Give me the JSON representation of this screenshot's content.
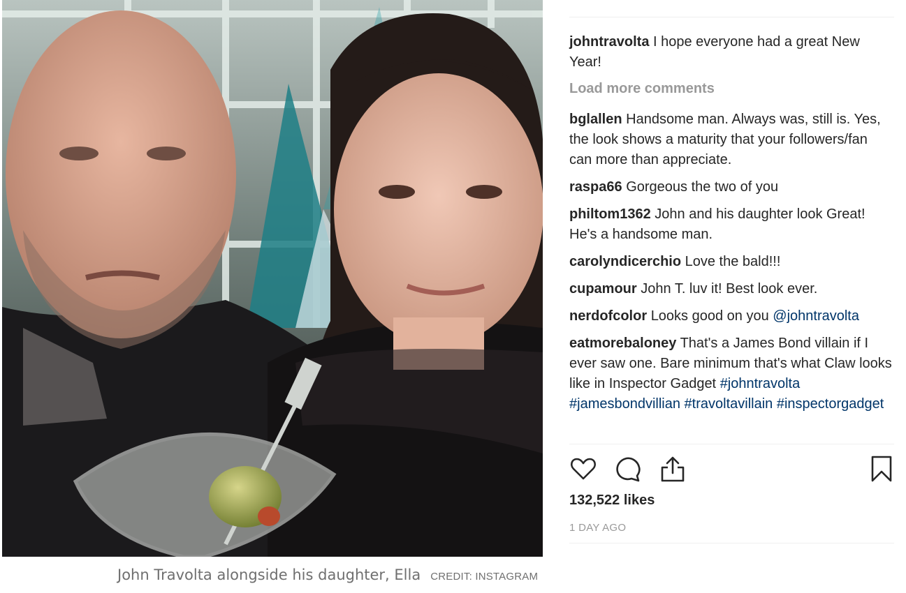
{
  "post": {
    "author": "johntravolta",
    "caption": "I hope everyone had a great New Year!",
    "load_more_label": "Load more comments",
    "comments": [
      {
        "user": "bglallen",
        "parts": [
          {
            "text": "Handsome man. Always was, still is. Yes, the look shows a maturity that your followers/fan can more than appreciate.",
            "tag": false
          }
        ]
      },
      {
        "user": "raspa66",
        "parts": [
          {
            "text": "Gorgeous the two of you",
            "tag": false
          }
        ]
      },
      {
        "user": "philtom1362",
        "parts": [
          {
            "text": "John and his daughter look Great! He's a handsome man.",
            "tag": false
          }
        ]
      },
      {
        "user": "carolyndicerchio",
        "parts": [
          {
            "text": "Love the bald!!!",
            "tag": false
          }
        ]
      },
      {
        "user": "cupamour",
        "parts": [
          {
            "text": "John T. luv it! Best look ever.",
            "tag": false
          }
        ]
      },
      {
        "user": "nerdofcolor",
        "parts": [
          {
            "text": "Looks good on you ",
            "tag": false
          },
          {
            "text": "@johntravolta",
            "tag": true
          }
        ]
      },
      {
        "user": "eatmorebaloney",
        "parts": [
          {
            "text": "That's a James Bond villain if I ever saw one. Bare minimum that's what Claw looks like in Inspector Gadget ",
            "tag": false
          },
          {
            "text": "#johntravolta",
            "tag": true
          },
          {
            "text": " ",
            "tag": false
          },
          {
            "text": "#jamesbondvillian",
            "tag": true
          },
          {
            "text": " ",
            "tag": false
          },
          {
            "text": "#travoltavillain",
            "tag": true
          },
          {
            "text": " ",
            "tag": false
          },
          {
            "text": "#inspectorgadget",
            "tag": true
          }
        ]
      }
    ],
    "likes": "132,522 likes",
    "timestamp": "1 DAY AGO",
    "icons": [
      "heart-icon",
      "comment-icon",
      "share-icon",
      "bookmark-icon"
    ]
  },
  "caption": {
    "text": "John Travolta alongside his daughter, Ella",
    "credit": "CREDIT: INSTAGRAM"
  },
  "colors": {
    "text": "#262626",
    "muted": "#999999",
    "hashtag": "#003569",
    "divider": "#efefef"
  }
}
